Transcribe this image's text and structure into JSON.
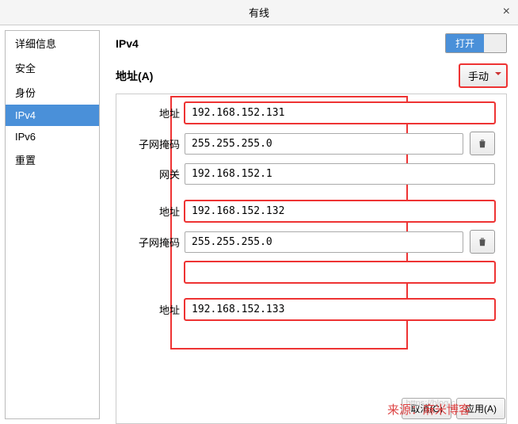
{
  "window": {
    "title": "有线",
    "close": "×"
  },
  "sidebar": {
    "items": [
      {
        "label": "详细信息"
      },
      {
        "label": "安全"
      },
      {
        "label": "身份"
      },
      {
        "label": "IPv4",
        "selected": true
      },
      {
        "label": "IPv6"
      },
      {
        "label": "重置"
      }
    ]
  },
  "header": {
    "title": "IPv4",
    "toggle_on": "打开"
  },
  "addresses": {
    "title": "地址(A)",
    "mode": "手动",
    "labels": {
      "address": "地址",
      "netmask": "子网掩码",
      "gateway": "网关"
    },
    "groups": [
      {
        "address": "192.168.152.131",
        "netmask": "255.255.255.0",
        "gateway": "192.168.152.1"
      },
      {
        "address": "192.168.152.132",
        "netmask": "255.255.255.0",
        "gateway": ""
      },
      {
        "address": "192.168.152.133"
      }
    ]
  },
  "buttons": {
    "cancel": "取消(C)",
    "apply": "应用(A)"
  },
  "watermark": "来源：麻米博客"
}
